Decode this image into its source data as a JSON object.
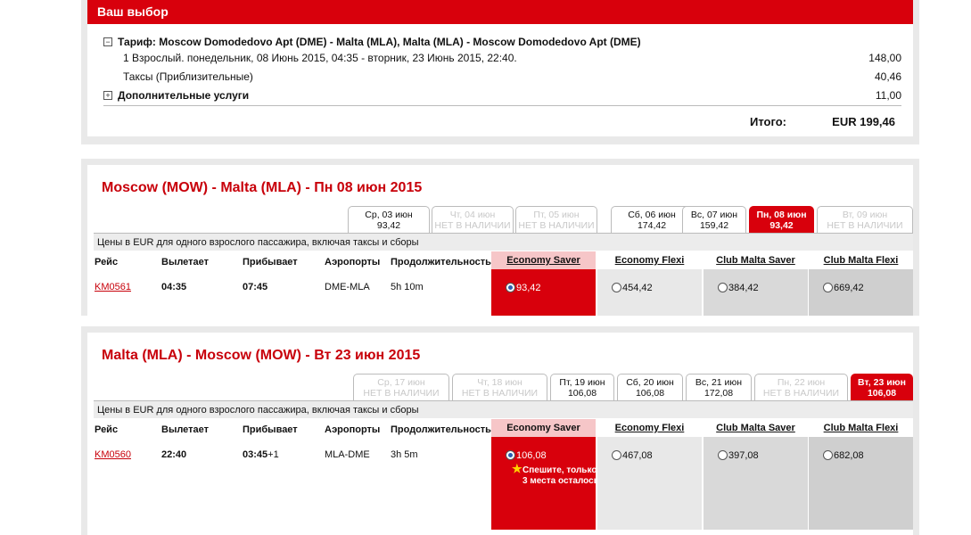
{
  "summary": {
    "title": "Ваш выбор",
    "fare_line": "Тариф: Moscow Domodedovo Apt (DME) - Malta (MLA), Malta (MLA) - Moscow Domodedovo Apt (DME)",
    "pax_line": "1 Взрослый. понедельник, 08 Июнь 2015, 04:35 - вторник, 23 Июнь 2015, 22:40.",
    "pax_amount": "148,00",
    "taxes_label": "Таксы (Приблизительные)",
    "taxes_amount": "40,46",
    "extras_label": "Дополнительные услуги",
    "extras_amount": "11,00",
    "total_label": "Итого:",
    "total_value": "EUR 199,46",
    "collapse_glyph": "−",
    "expand_glyph": "+"
  },
  "outbound": {
    "title": "Moscow (MOW) - Malta (MLA) - Пн 08 июн 2015",
    "tabs": [
      {
        "day": "Ср, 03 июн",
        "price": "93,42",
        "state": "available"
      },
      {
        "day": "Чт, 04 июн",
        "price": "НЕТ В НАЛИЧИИ",
        "state": "unavailable"
      },
      {
        "day": "Пт, 05 июн",
        "price": "НЕТ В НАЛИЧИИ",
        "state": "unavailable"
      },
      {
        "day": "Сб, 06 июн",
        "price": "174,42",
        "state": "available"
      },
      {
        "day": "Вс, 07 июн",
        "price": "159,42",
        "state": "available"
      },
      {
        "day": "Пн, 08 июн",
        "price": "93,42",
        "state": "selected"
      },
      {
        "day": "Вт, 09 июн",
        "price": "НЕТ В НАЛИЧИИ",
        "state": "unavailable"
      }
    ],
    "info": "Цены в EUR для одного взрослого пассажира, включая таксы и сборы",
    "flight": {
      "number": "KM0561",
      "depart": "04:35",
      "arrive": "07:45",
      "airports": "DME-MLA",
      "duration": "5h 10m"
    },
    "fares": [
      {
        "name": "Economy Saver",
        "price": "93,42",
        "selected": true
      },
      {
        "name": "Economy Flexi",
        "price": "454,42",
        "selected": false
      },
      {
        "name": "Club Malta Saver",
        "price": "384,42",
        "selected": false
      },
      {
        "name": "Club Malta Flexi",
        "price": "669,42",
        "selected": false
      }
    ]
  },
  "inbound": {
    "title": "Malta (MLA) - Moscow (MOW) - Вт 23 июн 2015",
    "tabs": [
      {
        "day": "Ср, 17 июн",
        "price": "НЕТ В НАЛИЧИИ",
        "state": "unavailable"
      },
      {
        "day": "Чт, 18 июн",
        "price": "НЕТ В НАЛИЧИИ",
        "state": "unavailable"
      },
      {
        "day": "Пт, 19 июн",
        "price": "106,08",
        "state": "available"
      },
      {
        "day": "Сб, 20 июн",
        "price": "106,08",
        "state": "available"
      },
      {
        "day": "Вс, 21 июн",
        "price": "172,08",
        "state": "available"
      },
      {
        "day": "Пн, 22 июн",
        "price": "НЕТ В НАЛИЧИИ",
        "state": "unavailable"
      },
      {
        "day": "Вт, 23 июн",
        "price": "106,08",
        "state": "selected"
      }
    ],
    "info": "Цены в EUR для одного взрослого пассажира, включая таксы и сборы",
    "flight": {
      "number": "KM0560",
      "depart": "22:40",
      "arrive": "03:45",
      "arrive_suffix": "+1",
      "airports": "MLA-DME",
      "duration": "3h 5m"
    },
    "fares": [
      {
        "name": "Economy Saver",
        "price": "106,08",
        "selected": true
      },
      {
        "name": "Economy Flexi",
        "price": "467,08",
        "selected": false
      },
      {
        "name": "Club Malta Saver",
        "price": "397,08",
        "selected": false
      },
      {
        "name": "Club Malta Flexi",
        "price": "682,08",
        "selected": false
      }
    ],
    "hurry_text": "Спешите, только 3 места осталось!"
  },
  "columns": {
    "flight": "Рейс",
    "depart": "Вылетает",
    "arrive": "Прибывает",
    "airports": "Аэропорты",
    "duration": "Продолжительность"
  },
  "colors": {
    "brand_red": "#d8000c",
    "selected_fare_bg": "#d8000c",
    "fare_bg_light": "#e8e8e8",
    "fare_bg_mid": "#d9d9d9",
    "fare_bg_dark": "#cfcfcf",
    "saver_header_bg": "#f6c6c8"
  },
  "icons": {
    "radio_selected": "radio-checked-icon",
    "radio_unselected": "radio-unchecked-icon",
    "hurry": "star-icon",
    "collapse": "minus-box-icon",
    "expand": "plus-box-icon"
  }
}
